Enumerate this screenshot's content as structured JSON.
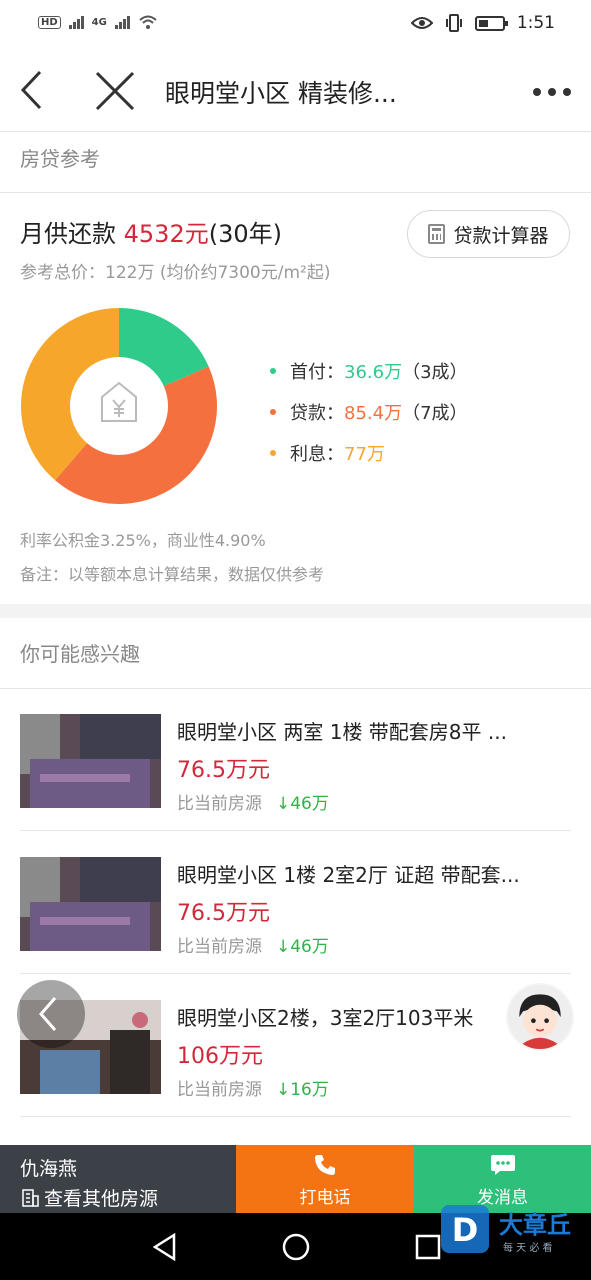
{
  "status_bar": {
    "time": "1:51",
    "hd": "HD",
    "network": "4G"
  },
  "header": {
    "title": "眼明堂小区 精装修..."
  },
  "mortgage": {
    "section_label": "房贷参考",
    "monthly_prefix": "月供还款 ",
    "monthly_amount": "4532元",
    "monthly_term": "(30年)",
    "calculator_label": "贷款计算器",
    "reference": "参考总价：122万 (均价约7300元/m²起)",
    "center_icon": "house-yen-icon",
    "legend": [
      {
        "label": "首付：",
        "value": "36.6万",
        "note": "（3成）",
        "color": "#2ecb8b"
      },
      {
        "label": "贷款：",
        "value": "85.4万",
        "note": "（7成）",
        "color": "#f4713f"
      },
      {
        "label": "利息：",
        "value": "77万",
        "note": "",
        "color": "#f7a62c"
      }
    ],
    "rate_note": "利率公积金3.25%，商业性4.90%",
    "remark": "备注：以等额本息计算结果，数据仅供参考"
  },
  "chart_data": {
    "type": "pie",
    "categories": [
      "首付",
      "贷款",
      "利息"
    ],
    "values": [
      36.6,
      85.4,
      77
    ],
    "colors": [
      "#2ecb8b",
      "#f4713f",
      "#f7a62c"
    ],
    "donut": true
  },
  "recommend": {
    "section_label": "你可能感兴趣",
    "items": [
      {
        "title": "眼明堂小区 两室 1楼 带配套房8平 ...",
        "price": "76.5万元",
        "compare": "比当前房源",
        "diff": "↓46万"
      },
      {
        "title": "眼明堂小区 1楼 2室2厅 证超 带配套...",
        "price": "76.5万元",
        "compare": "比当前房源",
        "diff": "↓46万"
      },
      {
        "title": "眼明堂小区2楼，3室2厅103平米",
        "price": "106万元",
        "compare": "比当前房源",
        "diff": "↓16万"
      }
    ]
  },
  "bottom_bar": {
    "agent_name": "仇海燕",
    "other_listings": "查看其他房源",
    "call_label": "打电话",
    "message_label": "发消息"
  },
  "watermark": {
    "brand": "大章丘",
    "slogan": "每 天 必 看",
    "letter": "D"
  }
}
